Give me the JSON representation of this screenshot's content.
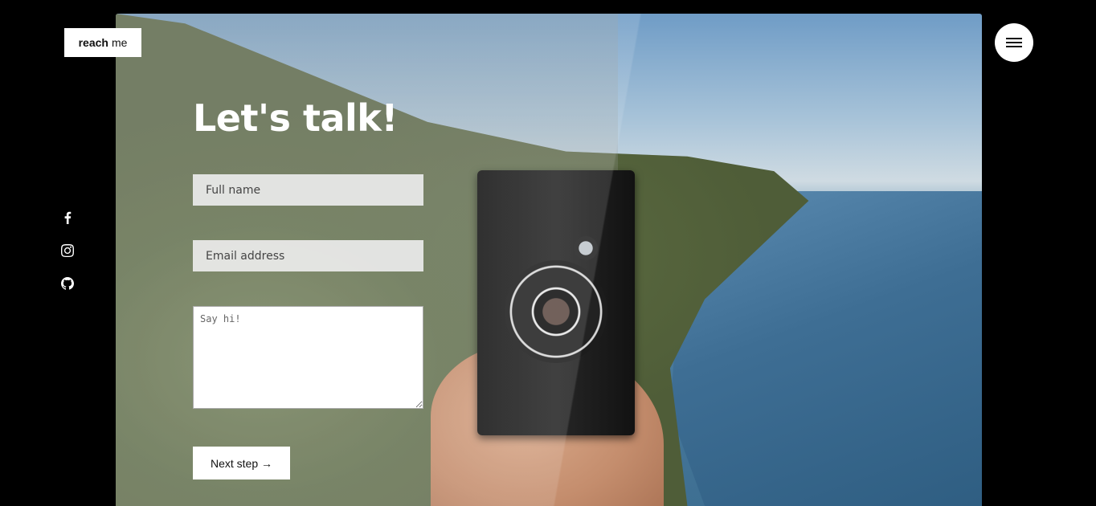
{
  "logo": {
    "bold": "reach",
    "light": "me"
  },
  "menu": {
    "icon": "hamburger-icon"
  },
  "social": [
    {
      "name": "facebook",
      "icon": "facebook-icon"
    },
    {
      "name": "instagram",
      "icon": "instagram-icon"
    },
    {
      "name": "github",
      "icon": "github-icon"
    }
  ],
  "form": {
    "title": "Let's talk!",
    "full_name_placeholder": "Full name",
    "email_placeholder": "Email address",
    "message_placeholder": "Say hi!",
    "next_button": "Next step →"
  },
  "colors": {
    "background": "#000000",
    "button_bg": "#ffffff",
    "title": "#ffffff"
  }
}
